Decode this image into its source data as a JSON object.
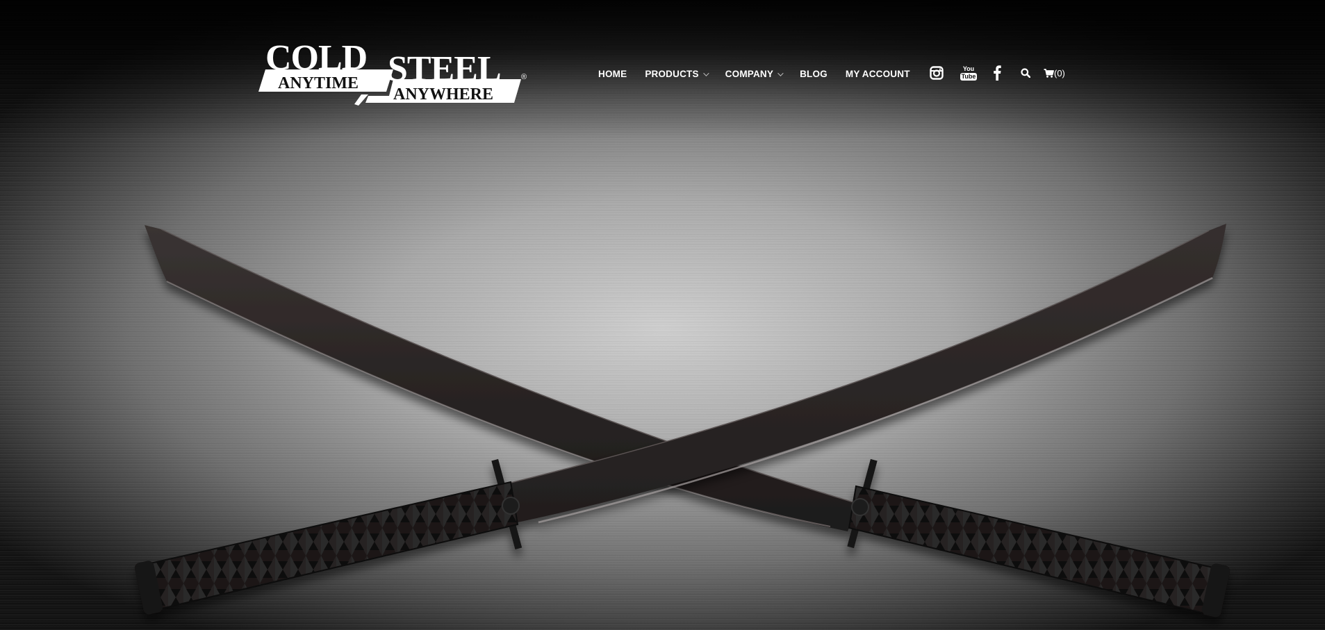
{
  "brand": {
    "logo_line1_left": "COLD",
    "logo_line1_right": "STEEL",
    "logo_tagline_left": "ANYTIME",
    "logo_tagline_right": "ANYWHERE",
    "logo_registered": "®"
  },
  "nav": {
    "items": [
      {
        "label": "HOME",
        "has_dropdown": false
      },
      {
        "label": "PRODUCTS",
        "has_dropdown": true
      },
      {
        "label": "COMPANY",
        "has_dropdown": true
      },
      {
        "label": "BLOG",
        "has_dropdown": false
      },
      {
        "label": "MY ACCOUNT",
        "has_dropdown": false
      }
    ]
  },
  "social": {
    "icons": [
      "instagram-icon",
      "youtube-icon",
      "facebook-icon",
      "search-icon"
    ],
    "youtube_text_top": "You",
    "youtube_text_bottom": "Tube"
  },
  "cart": {
    "count_label": "(0)"
  },
  "colors": {
    "nav_text": "#ffffff",
    "blade": "#2b2726",
    "handle": "#1c1a1a",
    "background_center": "#cfcfcf",
    "background_edge": "#111111"
  }
}
